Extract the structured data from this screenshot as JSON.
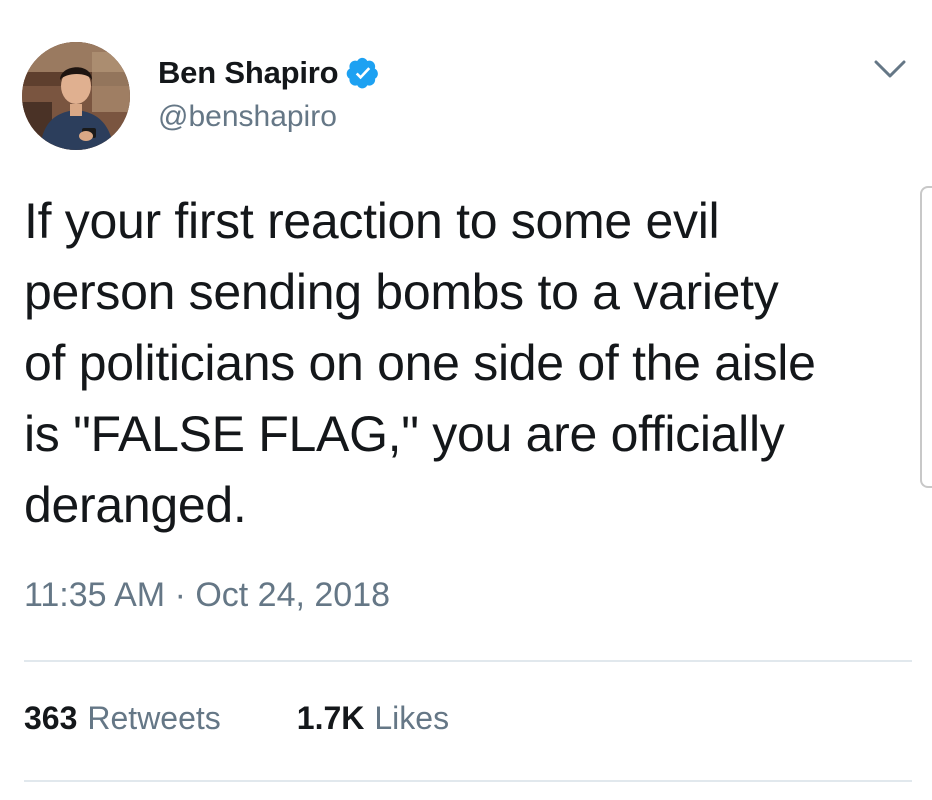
{
  "author": {
    "display_name": "Ben Shapiro",
    "handle": "@benshapiro",
    "verified": true,
    "verified_color": "#1da1f2"
  },
  "tweet": {
    "text_lines": [
      "If your first reaction to some evil",
      "person sending bombs to a variety",
      "of politicians on one side of the aisle",
      "is \"FALSE FLAG,\" you are officially",
      "deranged."
    ],
    "timestamp": "11:35 AM · Oct 24, 2018"
  },
  "stats": {
    "retweets_count": "363",
    "retweets_label": "Retweets",
    "likes_count": "1.7K",
    "likes_label": "Likes"
  },
  "icons": {
    "verified": "verified-badge-icon",
    "menu": "chevron-down-icon"
  }
}
